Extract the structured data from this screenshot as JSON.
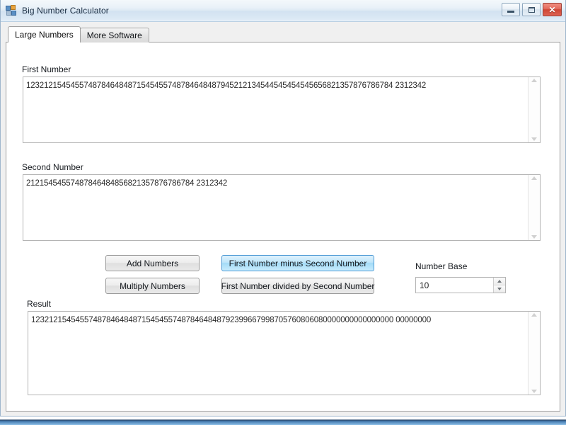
{
  "window": {
    "title": "Big Number Calculator",
    "icon": "app-icon",
    "buttons": {
      "minimize": "minimize",
      "maximize": "maximize",
      "close": "✕"
    }
  },
  "tabs": [
    {
      "label": "Large Numbers",
      "active": true
    },
    {
      "label": "More Software",
      "active": false
    }
  ],
  "form": {
    "first_number": {
      "label": "First Number",
      "value": "12321215454557487846484871545455748784648487945212134544545454545656821357876786784 2312342"
    },
    "second_number": {
      "label": "Second Number",
      "value": "21215454557487846484856821357876786784 2312342"
    },
    "result": {
      "label": "Result",
      "value": "1232121545455748784648487154545574878464848792399667998705760806080000000000000000 00000000"
    },
    "number_base": {
      "label": "Number Base",
      "value": "10"
    }
  },
  "actions": {
    "add": "Add Numbers",
    "multiply": "Multiply Numbers",
    "subtract": "First Number minus Second Number",
    "divide": "First Number divided by Second Number"
  },
  "colors": {
    "highlight": "#a3dbf7",
    "titlebar": "#d2e2f1",
    "close_button": "#cf4634"
  }
}
